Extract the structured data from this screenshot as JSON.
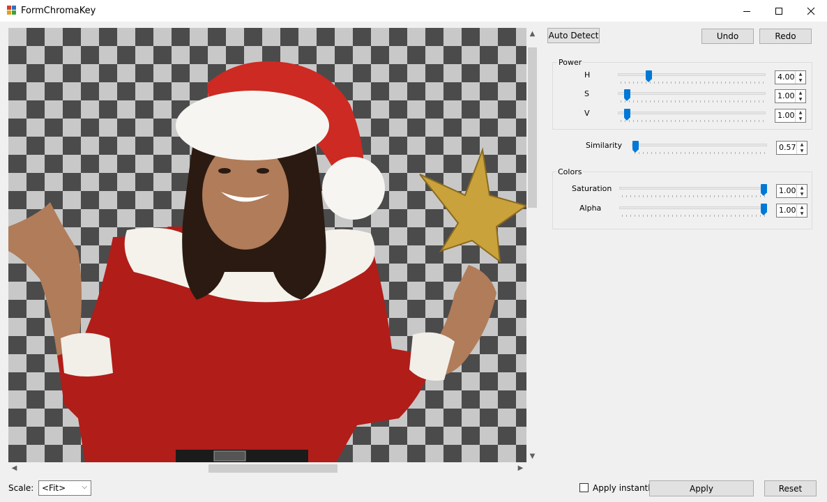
{
  "window": {
    "title": "FormChromaKey",
    "minimize_icon": "minimize-icon",
    "maximize_icon": "maximize-icon",
    "close_icon": "close-icon"
  },
  "toolbar": {
    "auto_detect_label": "Auto Detect",
    "undo_label": "Undo",
    "redo_label": "Redo"
  },
  "power": {
    "title": "Power",
    "h": {
      "label": "H",
      "value": "4.00"
    },
    "s": {
      "label": "S",
      "value": "1.00"
    },
    "v": {
      "label": "V",
      "value": "1.00"
    }
  },
  "similarity": {
    "label": "Similarity",
    "value": "0.57"
  },
  "colors": {
    "title": "Colors",
    "saturation": {
      "label": "Saturation",
      "value": "1.00"
    },
    "alpha": {
      "label": "Alpha",
      "value": "1.00"
    }
  },
  "footer": {
    "scale_label": "Scale:",
    "scale_value": "<Fit>",
    "apply_instantly_label": "Apply instantly",
    "apply_instantly_checked": false,
    "apply_label": "Apply",
    "reset_label": "Reset"
  },
  "image_subject": "woman in santa costume holding a gold star on transparent checkerboard"
}
